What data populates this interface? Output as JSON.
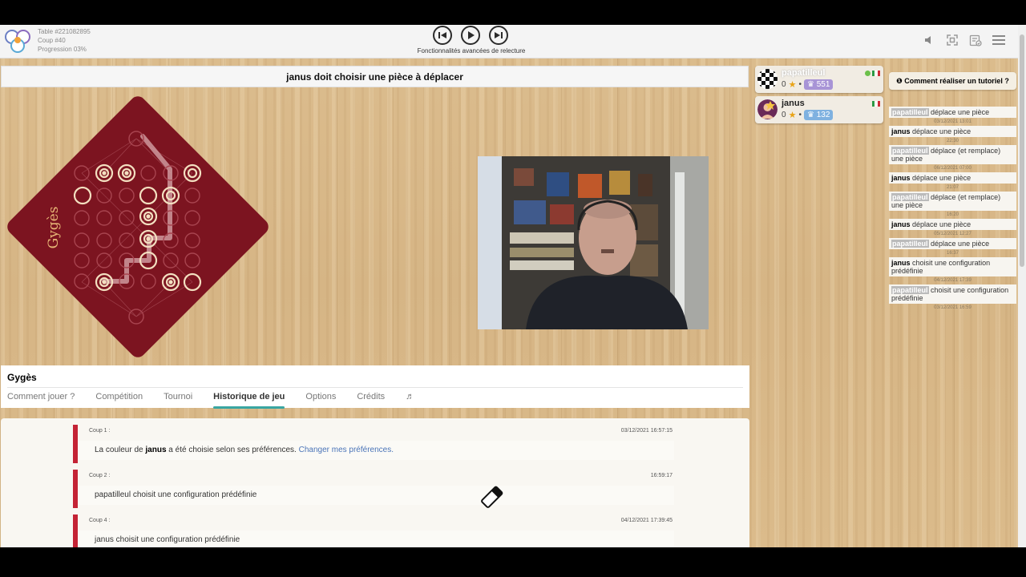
{
  "topbar": {
    "table_line": "Table #221082895",
    "move_line": "Coup #40",
    "progress_line": "Progression 03%",
    "replay_label": "Fonctionnalités avancées de relecture",
    "controls": [
      "previous-move",
      "play",
      "next-move"
    ],
    "right_icons": [
      "speaker-icon",
      "fullscreen-icon",
      "preferences-icon",
      "menu-icon"
    ]
  },
  "status": {
    "text": "janus doit choisir une pièce à déplacer"
  },
  "board": {
    "name": "Gygès",
    "background_color": "#7c1420",
    "accent_color": "#e8c79a"
  },
  "players": [
    {
      "name": "papatilleul",
      "stars": "0",
      "elo": "551",
      "online": true,
      "avatar": "chessboard-avatar"
    },
    {
      "name": "janus",
      "stars": "0",
      "elo": "132",
      "online": false,
      "avatar": "user-avatar"
    }
  ],
  "tutorial": {
    "label": "Comment réaliser un tutoriel ?"
  },
  "log": [
    {
      "player": "papatilleul",
      "highlight": true,
      "action": "déplace une pièce",
      "time": "03/12/2021 13:01"
    },
    {
      "player": "janus",
      "highlight": false,
      "action": "déplace une pièce",
      "time": "22:30"
    },
    {
      "player": "papatilleul",
      "highlight": true,
      "action": "déplace (et remplace) une pièce",
      "time": "06/12/2021 07:00"
    },
    {
      "player": "janus",
      "highlight": false,
      "action": "déplace une pièce",
      "time": "21:07"
    },
    {
      "player": "papatilleul",
      "highlight": true,
      "action": "déplace (et remplace) une pièce",
      "time": "16:20"
    },
    {
      "player": "janus",
      "highlight": false,
      "action": "déplace une pièce",
      "time": "05/12/2021 12:27"
    },
    {
      "player": "papatilleul",
      "highlight": true,
      "action": "déplace une pièce",
      "time": "16:37"
    },
    {
      "player": "janus",
      "highlight": false,
      "action": "choisit une configuration prédéfinie",
      "time": "04/12/2021 17:39"
    },
    {
      "player": "papatilleul",
      "highlight": true,
      "action": "choisit une configuration prédéfinie",
      "time": "03/12/2021 16:59"
    }
  ],
  "game_panel": {
    "title": "Gygès",
    "tabs": [
      "Comment jouer ?",
      "Compétition",
      "Tournoi",
      "Historique de jeu",
      "Options",
      "Crédits"
    ],
    "active_tab": "Historique de jeu",
    "music_icon": "music-note-icon"
  },
  "history": [
    {
      "label": "Coup 1 :",
      "date": "03/12/2021 16:57:15",
      "pre": "La couleur de ",
      "player": "janus",
      "post": " a été choisie selon ses préférences. ",
      "link": "Changer mes préférences."
    },
    {
      "label": "Coup 2 :",
      "date": "16:59:17",
      "text": "papatilleul choisit une configuration prédéfinie"
    },
    {
      "label": "Coup 4 :",
      "date": "04/12/2021 17:39:45",
      "text": "janus choisit une configuration prédéfinie"
    }
  ],
  "colors": {
    "accent_teal": "#39a6a2",
    "history_bar": "#c42335",
    "link": "#4a74b8"
  }
}
